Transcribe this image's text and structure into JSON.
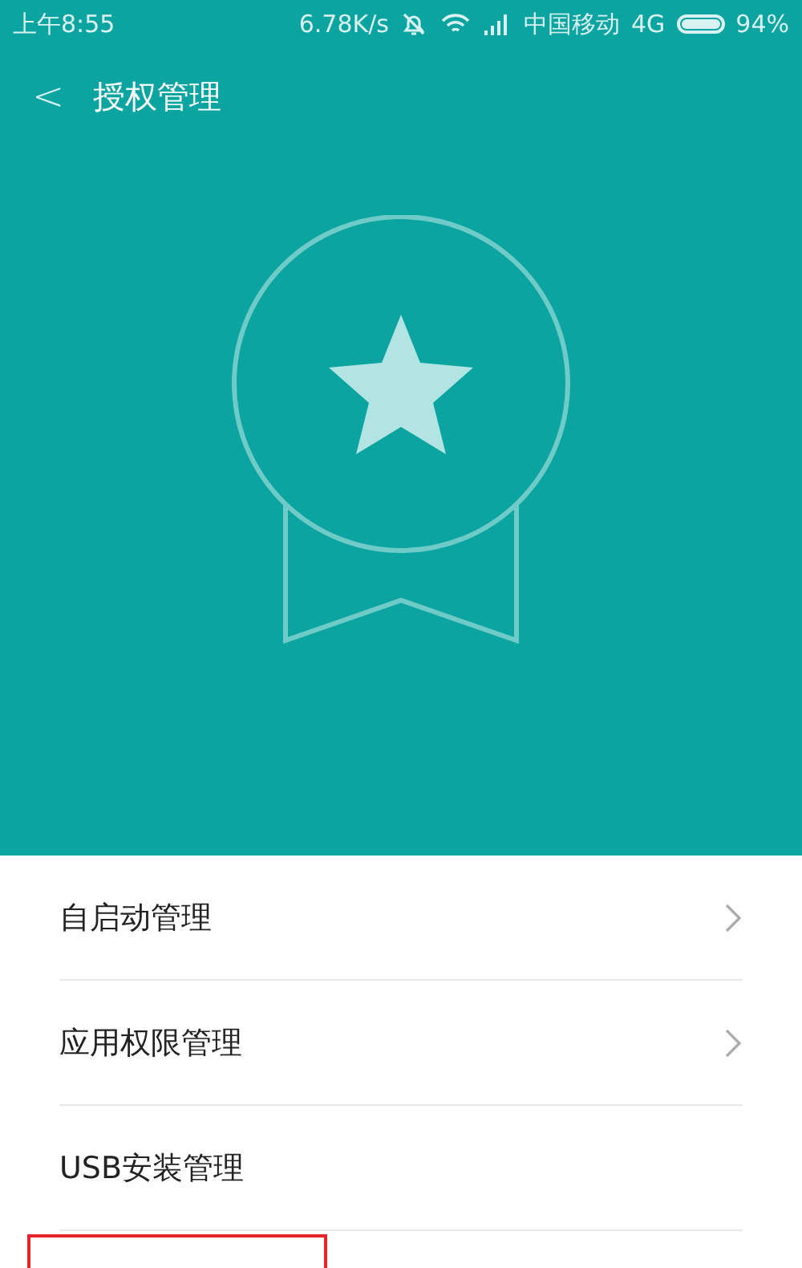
{
  "status_bar": {
    "time": "上午8:55",
    "speed": "6.78K/s",
    "carrier": "中国移动",
    "network": "4G",
    "battery": "94%"
  },
  "title_bar": {
    "back": "<",
    "title": "授权管理"
  },
  "menu": [
    {
      "label": "自启动管理",
      "chevron": true
    },
    {
      "label": "应用权限管理",
      "chevron": true
    },
    {
      "label": "USB安装管理",
      "chevron": false
    }
  ],
  "annotation": {
    "kind": "highlight-box"
  }
}
